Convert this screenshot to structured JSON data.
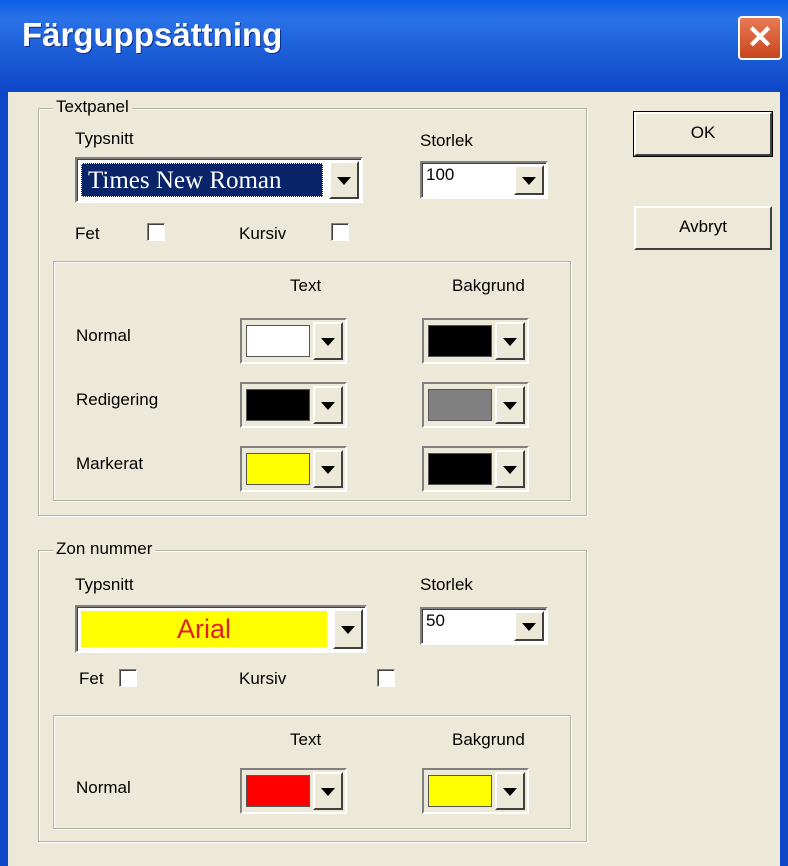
{
  "window": {
    "title": "Färguppsättning",
    "close_glyph": "✕"
  },
  "buttons": {
    "ok": "OK",
    "cancel": "Avbryt"
  },
  "textpanel": {
    "legend": "Textpanel",
    "font_label": "Typsnitt",
    "font_value": "Times New Roman",
    "size_label": "Storlek",
    "size_value": "100",
    "bold_label": "Fet",
    "italic_label": "Kursiv",
    "col_text": "Text",
    "col_background": "Bakgrund",
    "rows": [
      {
        "label": "Normal",
        "text_color": "#ffffff",
        "bg_color": "#000000"
      },
      {
        "label": "Redigering",
        "text_color": "#000000",
        "bg_color": "#808080"
      },
      {
        "label": "Markerat",
        "text_color": "#ffff00",
        "bg_color": "#000000"
      }
    ]
  },
  "zone": {
    "legend": "Zon nummer",
    "font_label": "Typsnitt",
    "font_value": "Arial",
    "size_label": "Storlek",
    "size_value": "50",
    "bold_label": "Fet",
    "italic_label": "Kursiv",
    "col_text": "Text",
    "col_background": "Bakgrund",
    "rows": [
      {
        "label": "Normal",
        "text_color": "#ff0000",
        "bg_color": "#ffff00"
      }
    ]
  },
  "colors": {
    "title_bar": "#0d46c7",
    "dialog_bg": "#ece9d8",
    "font_preview_bg": "#0a246a",
    "zone_font_fg": "#e02020",
    "zone_font_bg": "#ffff00"
  }
}
